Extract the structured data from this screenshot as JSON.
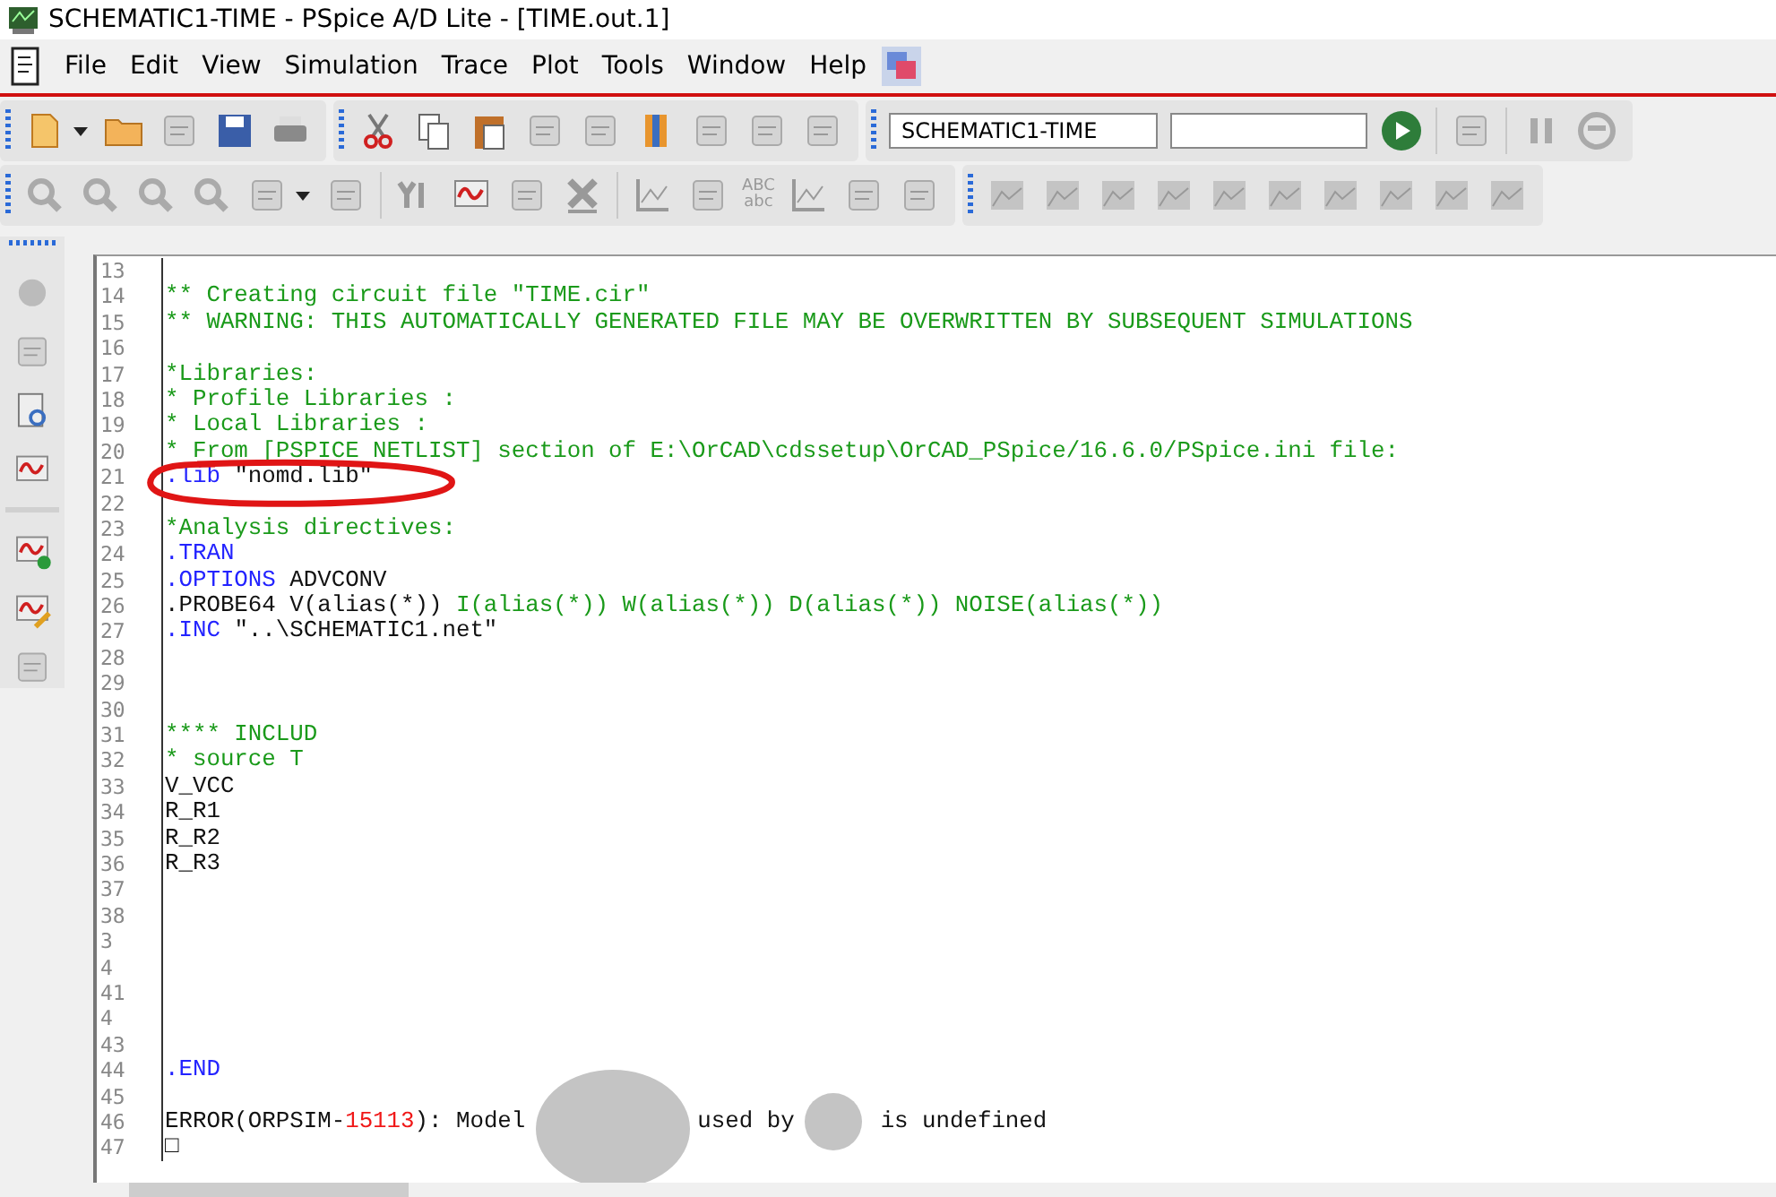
{
  "window": {
    "title": "SCHEMATIC1-TIME - PSpice A/D Lite - [TIME.out.1]"
  },
  "menu": [
    "File",
    "Edit",
    "View",
    "Simulation",
    "Trace",
    "Plot",
    "Tools",
    "Window",
    "Help"
  ],
  "toolbar": {
    "profile_field": {
      "value": "SCHEMATIC1-TIME"
    },
    "text_label_icon": [
      "ABC",
      "abc"
    ]
  },
  "editor": {
    "lines": [
      {
        "number": "13"
      },
      {
        "number": "14",
        "segments": [
          {
            "kind": "green",
            "text": "** Creating circuit file \"TIME.cir\""
          }
        ]
      },
      {
        "number": "15",
        "segments": [
          {
            "kind": "green",
            "text": "** WARNING: THIS AUTOMATICALLY GENERATED FILE MAY BE OVERWRITTEN BY SUBSEQUENT SIMULATIONS"
          }
        ]
      },
      {
        "number": "16"
      },
      {
        "number": "17",
        "segments": [
          {
            "kind": "green",
            "text": "*Libraries:"
          }
        ]
      },
      {
        "number": "18",
        "segments": [
          {
            "kind": "green",
            "text": "* Profile Libraries :"
          }
        ]
      },
      {
        "number": "19",
        "segments": [
          {
            "kind": "green",
            "text": "* Local Libraries :"
          }
        ]
      },
      {
        "number": "20",
        "segments": [
          {
            "kind": "green",
            "text": "* From [PSPICE NETLIST] section of E:\\OrCAD\\cdssetup\\OrCAD_PSpice/16.6.0/PSpice.ini file:"
          }
        ]
      },
      {
        "number": "21",
        "segments": [
          {
            "kind": "blue",
            "text": ".lib"
          },
          {
            "kind": "black",
            "text": " \"nomd.lib\""
          }
        ]
      },
      {
        "number": "22"
      },
      {
        "number": "23",
        "segments": [
          {
            "kind": "green",
            "text": "*Analysis directives:"
          }
        ]
      },
      {
        "number": "24",
        "segments": [
          {
            "kind": "blue",
            "text": ".TRAN"
          }
        ]
      },
      {
        "number": "25",
        "segments": [
          {
            "kind": "blue",
            "text": ".OPTIONS"
          },
          {
            "kind": "black",
            "text": " ADVCONV"
          }
        ]
      },
      {
        "number": "26",
        "segments": [
          {
            "kind": "black",
            "text": ".PROBE64 V(alias(*)) "
          },
          {
            "kind": "green",
            "text": "I(alias(*)) W(alias(*)) D(alias(*)) NOISE(alias(*))"
          }
        ]
      },
      {
        "number": "27",
        "segments": [
          {
            "kind": "blue",
            "text": ".INC"
          },
          {
            "kind": "black",
            "text": " \"..\\SCHEMATIC1.net\""
          }
        ]
      },
      {
        "number": "28"
      },
      {
        "number": "29"
      },
      {
        "number": "30"
      },
      {
        "number": "31",
        "segments": [
          {
            "kind": "green",
            "text": "**** INCLUD"
          }
        ]
      },
      {
        "number": "32",
        "segments": [
          {
            "kind": "green",
            "text": "* source T"
          }
        ]
      },
      {
        "number": "33",
        "segments": [
          {
            "kind": "black",
            "text": "V_VCC"
          }
        ]
      },
      {
        "number": "34",
        "segments": [
          {
            "kind": "black",
            "text": "R_R1"
          }
        ]
      },
      {
        "number": "35",
        "segments": [
          {
            "kind": "black",
            "text": "R_R2"
          }
        ]
      },
      {
        "number": "36",
        "segments": [
          {
            "kind": "black",
            "text": "R_R3"
          }
        ]
      },
      {
        "number": "37"
      },
      {
        "number": "38"
      },
      {
        "number": "3"
      },
      {
        "number": "4"
      },
      {
        "number": "41"
      },
      {
        "number": "4"
      },
      {
        "number": "43"
      },
      {
        "number": "44",
        "segments": [
          {
            "kind": "blue",
            "text": ".END"
          }
        ]
      },
      {
        "number": "45"
      },
      {
        "number": "46",
        "segments": [
          {
            "kind": "black",
            "text": "ERROR(ORPSIM-"
          },
          {
            "kind": "red",
            "text": "15113"
          },
          {
            "kind": "black",
            "text": "): Model"
          },
          {
            "kind": "redaction"
          },
          {
            "kind": "black",
            "text": "used by"
          },
          {
            "kind": "redaction"
          },
          {
            "kind": "black",
            "text": "is undefined"
          }
        ]
      },
      {
        "number": "47",
        "segments": [
          {
            "kind": "black",
            "text": "□"
          }
        ]
      }
    ]
  }
}
